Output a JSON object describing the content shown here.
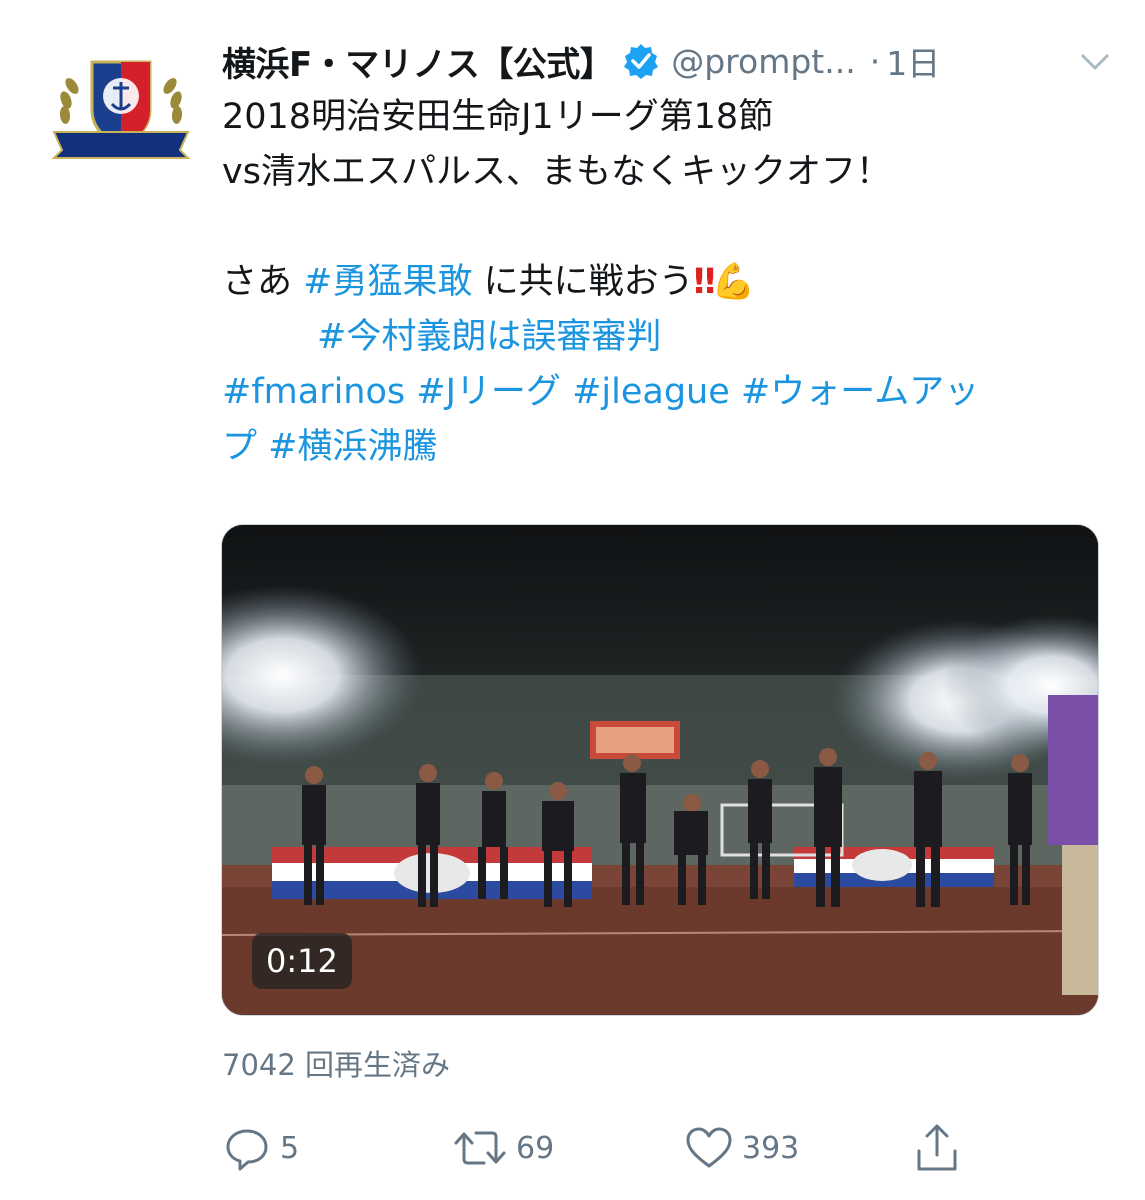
{
  "tweet": {
    "author_name": "横浜F・マリノス【公式】",
    "handle": "@prompt...",
    "separator": "·",
    "time": "1日",
    "avatar_label": "Yokohama F·Marinos",
    "lines": [
      "2018明治安田生命J1リーグ第18節",
      "vs清水エスパルス、まもなくキックオフ！"
    ],
    "line3_prefix": "さあ ",
    "line3_tag": "#勇猛果敢",
    "line3_suffix": " に共に戦おう",
    "line3_bang": "‼",
    "line3_emoji": "💪",
    "line4_tag": "#今村義朗は誤審審判",
    "hashtags_row1": [
      "#fmarinos",
      "#Jリーグ",
      "#jleague",
      "#ウォームアッ"
    ],
    "hashtags_row2": [
      "プ",
      "#横浜沸騰"
    ]
  },
  "video": {
    "duration": "0:12"
  },
  "stats": {
    "views": "7042 回再生済み",
    "replies": "5",
    "retweets": "69",
    "likes": "393"
  },
  "icons": {
    "verified": "verified-badge-icon",
    "chevron": "chevron-down-icon",
    "reply": "reply-icon",
    "retweet": "retweet-icon",
    "like": "heart-icon",
    "share": "share-icon"
  },
  "colors": {
    "link": "#1b95e0",
    "secondary": "#657786",
    "verified": "#1da1f2"
  }
}
